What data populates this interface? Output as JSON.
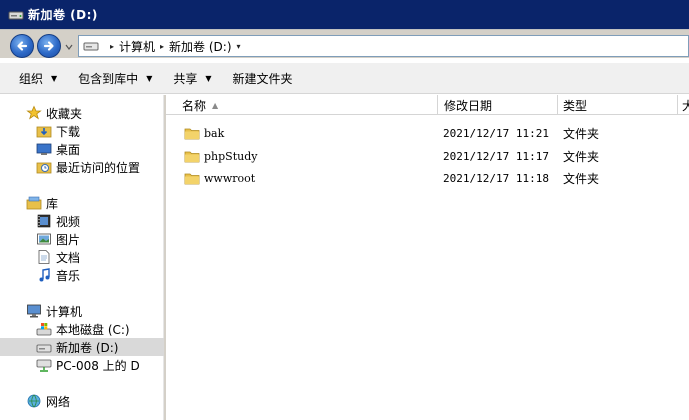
{
  "window": {
    "title": "新加卷 (D:)"
  },
  "address": {
    "crumbs": [
      "计算机",
      "新加卷 (D:)"
    ]
  },
  "toolbar": {
    "organize": "组织",
    "include_library": "包含到库中",
    "share": "共享",
    "new_folder": "新建文件夹"
  },
  "nav": {
    "favorites": "收藏夹",
    "downloads": "下载",
    "desktop": "桌面",
    "recent": "最近访问的位置",
    "libraries": "库",
    "videos": "视频",
    "pictures": "图片",
    "documents": "文档",
    "music": "音乐",
    "computer": "计算机",
    "local_disk": "本地磁盘 (C:)",
    "new_volume": "新加卷 (D:)",
    "network_drive": "PC-008 上的 D",
    "network": "网络"
  },
  "columns": {
    "name": "名称",
    "date": "修改日期",
    "type": "类型",
    "size": "大"
  },
  "files": [
    {
      "name": "bak",
      "date": "2021/12/17 11:21",
      "type": "文件夹"
    },
    {
      "name": "phpStudy",
      "date": "2021/12/17 11:17",
      "type": "文件夹"
    },
    {
      "name": "wwwroot",
      "date": "2021/12/17 11:18",
      "type": "文件夹"
    }
  ],
  "colors": {
    "titlebar": "#0a246a",
    "selection": "#d9d9d9",
    "folder": "#e8c04a"
  },
  "icons": {
    "titlebar": "drive-icon",
    "back": "back-arrow-icon",
    "forward": "forward-arrow-icon",
    "favorites": "star-icon",
    "downloads": "download-folder-icon",
    "desktop": "desktop-icon",
    "recent": "recent-places-icon",
    "libraries": "library-icon",
    "videos": "video-icon",
    "pictures": "picture-icon",
    "documents": "document-icon",
    "music": "music-icon",
    "computer": "computer-icon",
    "local_disk": "local-disk-icon",
    "new_volume": "drive-icon",
    "network_drive": "network-drive-icon",
    "network": "network-icon",
    "folder": "folder-icon"
  }
}
